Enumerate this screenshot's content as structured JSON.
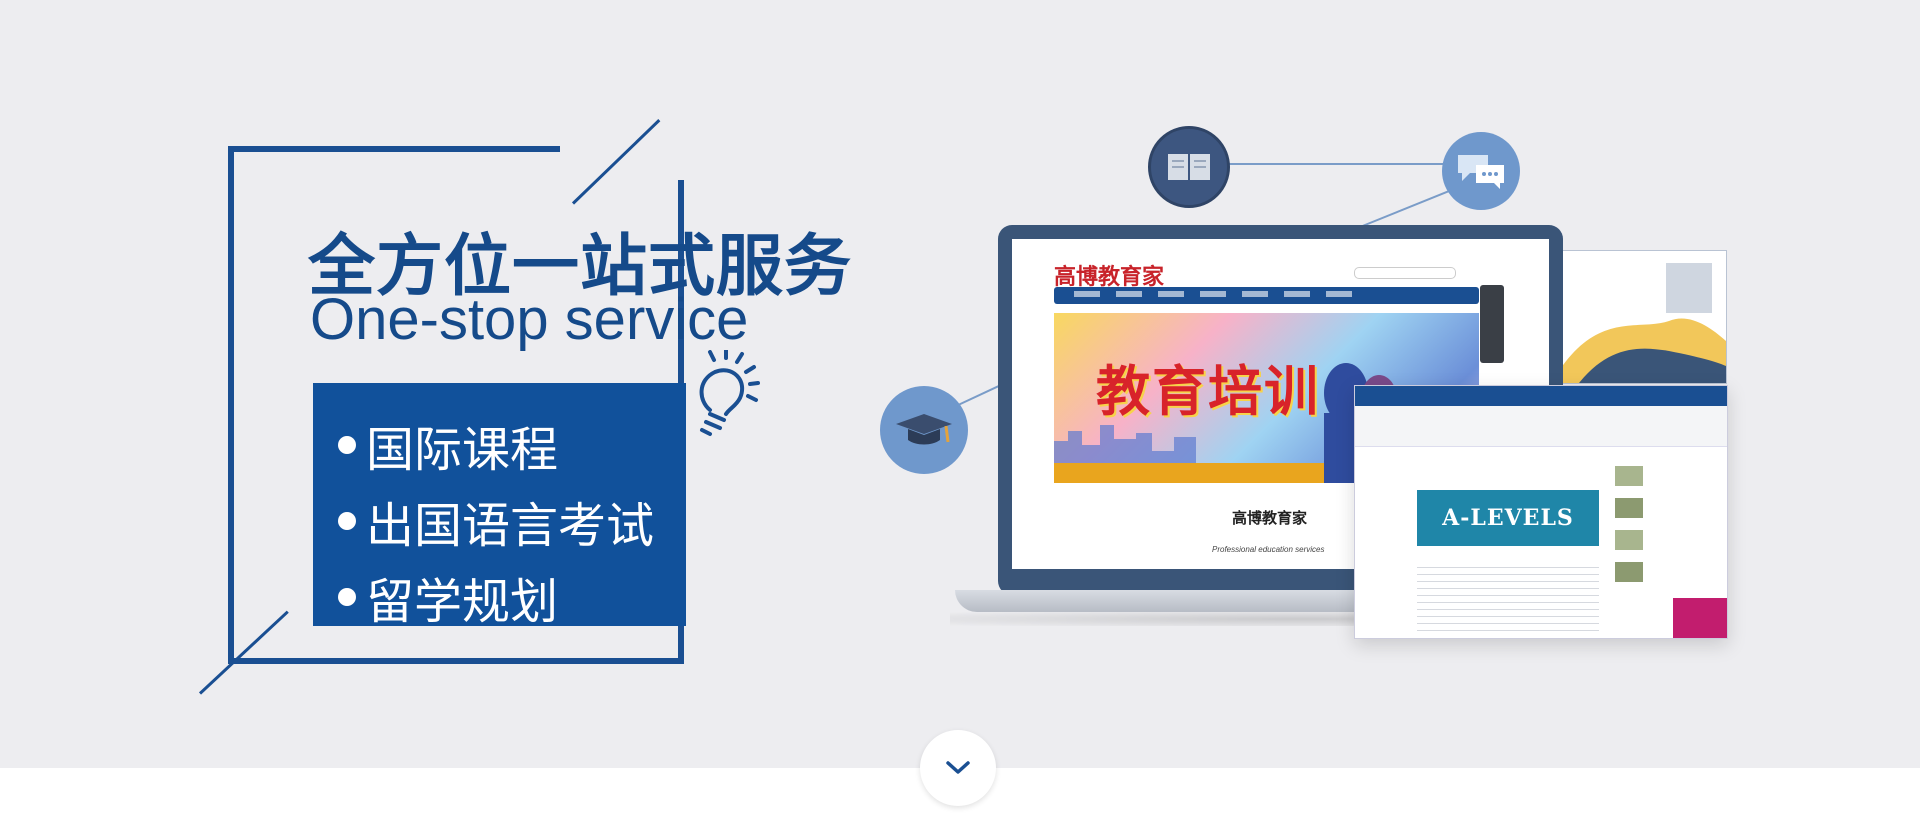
{
  "headline": "全方位一站式服务",
  "subheadline": "One-stop service",
  "services": [
    "国际课程",
    "出国语言考试",
    "留学规划"
  ],
  "mockup": {
    "brand": "高博教育家",
    "banner_text": "教育培训",
    "tagline": "Professional education services",
    "second_banner": "A-LEVELS"
  },
  "icons": {
    "book": "book-icon",
    "chat": "chat-bubbles-icon",
    "cap": "graduation-cap-icon",
    "bulb": "lightbulb-icon",
    "scroll": "chevron-down-icon"
  },
  "colors": {
    "primary": "#11519b",
    "background": "#ededf0"
  }
}
